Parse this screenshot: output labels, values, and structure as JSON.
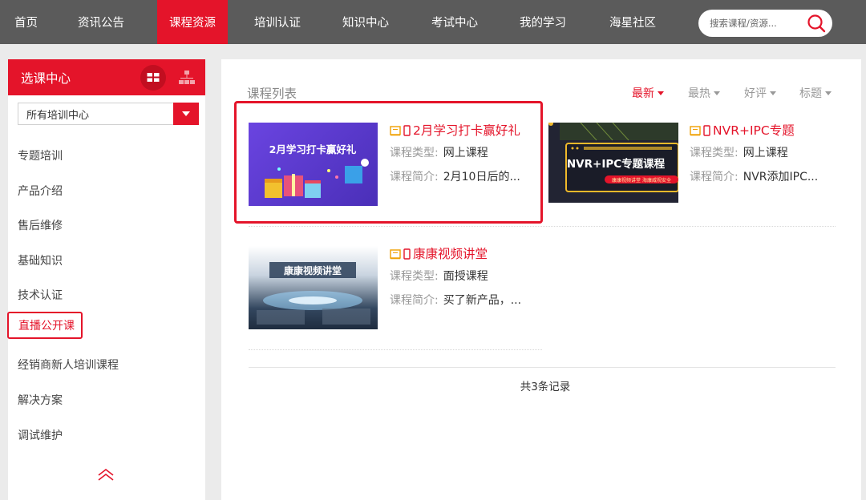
{
  "nav": {
    "items": [
      "首页",
      "资讯公告",
      "课程资源",
      "培训认证",
      "知识中心",
      "考试中心",
      "我的学习",
      "海星社区"
    ],
    "active_index": 2,
    "search_placeholder": "搜索课程/资源..."
  },
  "sidebar": {
    "title": "选课中心",
    "select_value": "所有培训中心",
    "items": [
      "专题培训",
      "产品介绍",
      "售后维修",
      "基础知识",
      "技术认证",
      "直播公开课",
      "经销商新人培训课程",
      "解决方案",
      "调试维护"
    ],
    "highlighted_index": 5
  },
  "main": {
    "title": "课程列表",
    "sorts": [
      "最新",
      "最热",
      "好评",
      "标题"
    ],
    "active_sort": 0,
    "labels": {
      "type": "课程类型:",
      "intro": "课程简介:"
    },
    "courses": [
      {
        "title": "2月学习打卡赢好礼",
        "type": "网上课程",
        "intro": "2月10日后的...",
        "thumb_text": "2月学习打卡赢好礼",
        "thumb_bg": "#5b3fd6"
      },
      {
        "title": "NVR+IPC专题",
        "type": "网上课程",
        "intro": "NVR添加IPC...",
        "thumb_text": "NVR+IPC专题课程",
        "thumb_sub": "康康视频讲堂 海康威视安全",
        "thumb_bg": "#1e1e2e"
      },
      {
        "title": "康康视频讲堂",
        "type": "面授课程",
        "intro": "买了新产品，...",
        "thumb_text": "康康视频讲堂",
        "thumb_bg": "#3a4f6a"
      }
    ],
    "record_count": "共3条记录"
  },
  "colors": {
    "brand_red": "#e4142a",
    "nav_bg": "#5b5b5b",
    "page_bg": "#ebebeb",
    "link_orange": "#f0a000"
  }
}
